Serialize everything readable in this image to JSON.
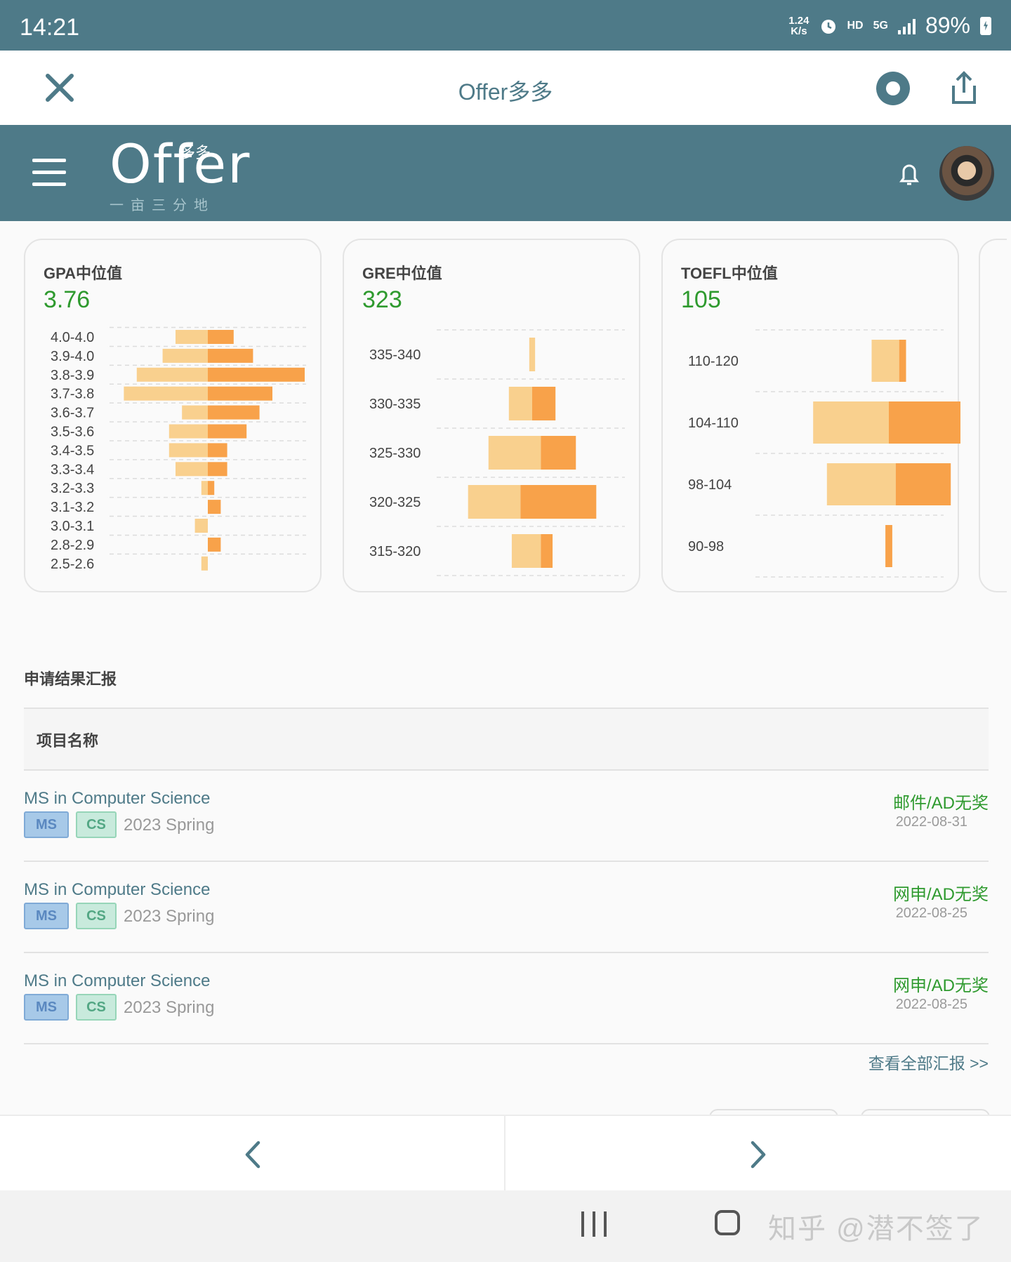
{
  "status_bar": {
    "time": "14:21",
    "net_speed_value": "1.24",
    "net_speed_unit": "K/s",
    "hd": "HD",
    "network": "5G",
    "battery": "89%"
  },
  "browser": {
    "title": "Offer多多",
    "icons": [
      "close-icon",
      "chrome-icon",
      "share-icon"
    ]
  },
  "app_header": {
    "logo_main": "Offer",
    "logo_badge": "多多",
    "logo_tagline": "一亩三分地",
    "icons": [
      "menu-icon",
      "bell-icon",
      "avatar"
    ]
  },
  "stats": [
    {
      "title": "GPA中位值",
      "value": "3.76"
    },
    {
      "title": "GRE中位值",
      "value": "323"
    },
    {
      "title": "TOEFL中位值",
      "value": "105"
    }
  ],
  "chart_data": [
    {
      "type": "bar",
      "orientation": "horizontal",
      "style": "diverging-stacked",
      "categories": [
        "4.0-4.0",
        "3.9-4.0",
        "3.8-3.9",
        "3.7-3.8",
        "3.6-3.7",
        "3.5-3.6",
        "3.4-3.5",
        "3.3-3.4",
        "3.2-3.3",
        "3.1-3.2",
        "3.0-3.1",
        "2.8-2.9",
        "2.5-2.6"
      ],
      "series": [
        {
          "color": "#f9d08e",
          "values": [
            5,
            7,
            11,
            13,
            4,
            6,
            6,
            5,
            1,
            0,
            2,
            0,
            1
          ]
        },
        {
          "color": "#f8a24a",
          "values": [
            4,
            7,
            15,
            10,
            8,
            6,
            3,
            3,
            1,
            2,
            0,
            2,
            0
          ]
        }
      ],
      "colors": {
        "light": "#f9d08e",
        "dark": "#f8a24a"
      }
    },
    {
      "type": "bar",
      "orientation": "horizontal",
      "style": "stacked",
      "categories": [
        "335-340",
        "330-335",
        "325-330",
        "320-325",
        "315-320"
      ],
      "series": [
        {
          "color": "#f9d08e",
          "values": [
            1,
            4,
            9,
            9,
            5
          ]
        },
        {
          "color": "#f8a24a",
          "values": [
            0,
            4,
            6,
            13,
            2
          ]
        }
      ]
    },
    {
      "type": "bar",
      "orientation": "horizontal",
      "style": "stacked",
      "categories": [
        "110-120",
        "104-110",
        "98-104",
        "90-98"
      ],
      "series": [
        {
          "color": "#f9d08e",
          "values": [
            4,
            11,
            10,
            0
          ]
        },
        {
          "color": "#f8a24a",
          "values": [
            1,
            11,
            8,
            1
          ]
        }
      ]
    }
  ],
  "results": {
    "section_title": "申请结果汇报",
    "column_header": "项目名称",
    "rows": [
      {
        "program": "MS in Computer Science",
        "tag1": "MS",
        "tag2": "CS",
        "term": "2023 Spring",
        "result": "邮件/AD无奖",
        "date": "2022-08-31"
      },
      {
        "program": "MS in Computer Science",
        "tag1": "MS",
        "tag2": "CS",
        "term": "2023 Spring",
        "result": "网申/AD无奖",
        "date": "2022-08-25"
      },
      {
        "program": "MS in Computer Science",
        "tag1": "MS",
        "tag2": "CS",
        "term": "2023 Spring",
        "result": "网申/AD无奖",
        "date": "2022-08-25"
      }
    ],
    "view_all": "查看全部汇报 >>"
  },
  "bottom_nav": {
    "icons": [
      "back-arrow-icon",
      "forward-arrow-icon"
    ]
  },
  "system_nav": {
    "icons": [
      "recents-icon",
      "home-icon"
    ],
    "watermark": "知乎 @潜不签了"
  }
}
